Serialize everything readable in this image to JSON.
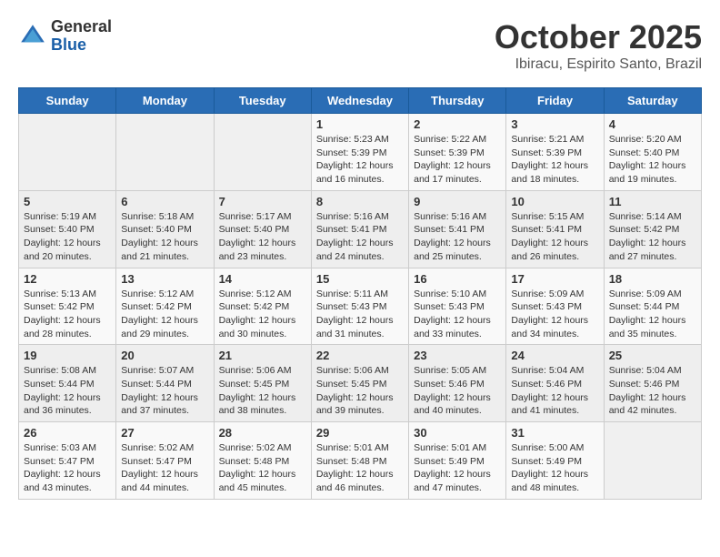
{
  "header": {
    "logo_general": "General",
    "logo_blue": "Blue",
    "month_title": "October 2025",
    "subtitle": "Ibiracu, Espirito Santo, Brazil"
  },
  "weekdays": [
    "Sunday",
    "Monday",
    "Tuesday",
    "Wednesday",
    "Thursday",
    "Friday",
    "Saturday"
  ],
  "weeks": [
    [
      {
        "day": "",
        "info": ""
      },
      {
        "day": "",
        "info": ""
      },
      {
        "day": "",
        "info": ""
      },
      {
        "day": "1",
        "info": "Sunrise: 5:23 AM\nSunset: 5:39 PM\nDaylight: 12 hours\nand 16 minutes."
      },
      {
        "day": "2",
        "info": "Sunrise: 5:22 AM\nSunset: 5:39 PM\nDaylight: 12 hours\nand 17 minutes."
      },
      {
        "day": "3",
        "info": "Sunrise: 5:21 AM\nSunset: 5:39 PM\nDaylight: 12 hours\nand 18 minutes."
      },
      {
        "day": "4",
        "info": "Sunrise: 5:20 AM\nSunset: 5:40 PM\nDaylight: 12 hours\nand 19 minutes."
      }
    ],
    [
      {
        "day": "5",
        "info": "Sunrise: 5:19 AM\nSunset: 5:40 PM\nDaylight: 12 hours\nand 20 minutes."
      },
      {
        "day": "6",
        "info": "Sunrise: 5:18 AM\nSunset: 5:40 PM\nDaylight: 12 hours\nand 21 minutes."
      },
      {
        "day": "7",
        "info": "Sunrise: 5:17 AM\nSunset: 5:40 PM\nDaylight: 12 hours\nand 23 minutes."
      },
      {
        "day": "8",
        "info": "Sunrise: 5:16 AM\nSunset: 5:41 PM\nDaylight: 12 hours\nand 24 minutes."
      },
      {
        "day": "9",
        "info": "Sunrise: 5:16 AM\nSunset: 5:41 PM\nDaylight: 12 hours\nand 25 minutes."
      },
      {
        "day": "10",
        "info": "Sunrise: 5:15 AM\nSunset: 5:41 PM\nDaylight: 12 hours\nand 26 minutes."
      },
      {
        "day": "11",
        "info": "Sunrise: 5:14 AM\nSunset: 5:42 PM\nDaylight: 12 hours\nand 27 minutes."
      }
    ],
    [
      {
        "day": "12",
        "info": "Sunrise: 5:13 AM\nSunset: 5:42 PM\nDaylight: 12 hours\nand 28 minutes."
      },
      {
        "day": "13",
        "info": "Sunrise: 5:12 AM\nSunset: 5:42 PM\nDaylight: 12 hours\nand 29 minutes."
      },
      {
        "day": "14",
        "info": "Sunrise: 5:12 AM\nSunset: 5:42 PM\nDaylight: 12 hours\nand 30 minutes."
      },
      {
        "day": "15",
        "info": "Sunrise: 5:11 AM\nSunset: 5:43 PM\nDaylight: 12 hours\nand 31 minutes."
      },
      {
        "day": "16",
        "info": "Sunrise: 5:10 AM\nSunset: 5:43 PM\nDaylight: 12 hours\nand 33 minutes."
      },
      {
        "day": "17",
        "info": "Sunrise: 5:09 AM\nSunset: 5:43 PM\nDaylight: 12 hours\nand 34 minutes."
      },
      {
        "day": "18",
        "info": "Sunrise: 5:09 AM\nSunset: 5:44 PM\nDaylight: 12 hours\nand 35 minutes."
      }
    ],
    [
      {
        "day": "19",
        "info": "Sunrise: 5:08 AM\nSunset: 5:44 PM\nDaylight: 12 hours\nand 36 minutes."
      },
      {
        "day": "20",
        "info": "Sunrise: 5:07 AM\nSunset: 5:44 PM\nDaylight: 12 hours\nand 37 minutes."
      },
      {
        "day": "21",
        "info": "Sunrise: 5:06 AM\nSunset: 5:45 PM\nDaylight: 12 hours\nand 38 minutes."
      },
      {
        "day": "22",
        "info": "Sunrise: 5:06 AM\nSunset: 5:45 PM\nDaylight: 12 hours\nand 39 minutes."
      },
      {
        "day": "23",
        "info": "Sunrise: 5:05 AM\nSunset: 5:46 PM\nDaylight: 12 hours\nand 40 minutes."
      },
      {
        "day": "24",
        "info": "Sunrise: 5:04 AM\nSunset: 5:46 PM\nDaylight: 12 hours\nand 41 minutes."
      },
      {
        "day": "25",
        "info": "Sunrise: 5:04 AM\nSunset: 5:46 PM\nDaylight: 12 hours\nand 42 minutes."
      }
    ],
    [
      {
        "day": "26",
        "info": "Sunrise: 5:03 AM\nSunset: 5:47 PM\nDaylight: 12 hours\nand 43 minutes."
      },
      {
        "day": "27",
        "info": "Sunrise: 5:02 AM\nSunset: 5:47 PM\nDaylight: 12 hours\nand 44 minutes."
      },
      {
        "day": "28",
        "info": "Sunrise: 5:02 AM\nSunset: 5:48 PM\nDaylight: 12 hours\nand 45 minutes."
      },
      {
        "day": "29",
        "info": "Sunrise: 5:01 AM\nSunset: 5:48 PM\nDaylight: 12 hours\nand 46 minutes."
      },
      {
        "day": "30",
        "info": "Sunrise: 5:01 AM\nSunset: 5:49 PM\nDaylight: 12 hours\nand 47 minutes."
      },
      {
        "day": "31",
        "info": "Sunrise: 5:00 AM\nSunset: 5:49 PM\nDaylight: 12 hours\nand 48 minutes."
      },
      {
        "day": "",
        "info": ""
      }
    ]
  ]
}
